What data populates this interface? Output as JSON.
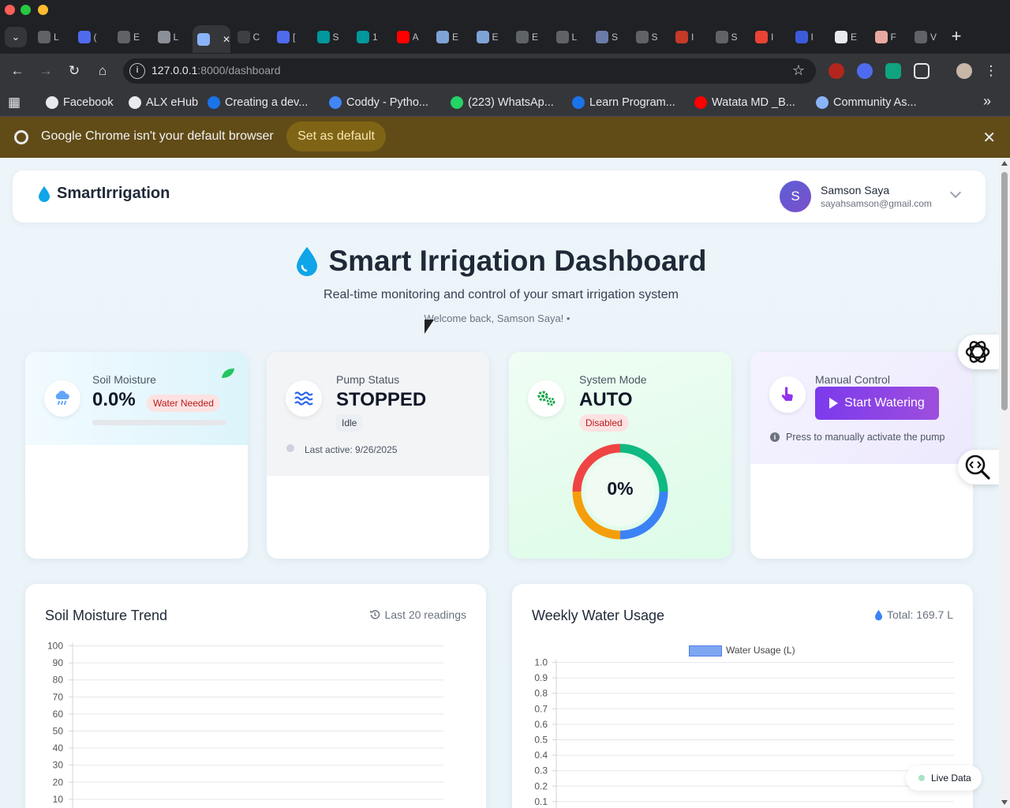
{
  "browser": {
    "tabs": [
      {
        "title": "L",
        "color": "#5f6368"
      },
      {
        "title": "(",
        "color": "#4f6bed"
      },
      {
        "title": "E",
        "color": "#5f6368"
      },
      {
        "title": "L",
        "color": "#8a8f98"
      },
      {
        "title": "",
        "color": "#8ab4f8",
        "active": true
      },
      {
        "title": "C",
        "color": "#3c4043"
      },
      {
        "title": "[",
        "color": "#4f6bed"
      },
      {
        "title": "S",
        "color": "#00979d"
      },
      {
        "title": "1",
        "color": "#00979d"
      },
      {
        "title": "A",
        "color": "#ff0000"
      },
      {
        "title": "E",
        "color": "#7ea3d6"
      },
      {
        "title": "E",
        "color": "#7ea3d6"
      },
      {
        "title": "E",
        "color": "#5f6368"
      },
      {
        "title": "L",
        "color": "#5f6368"
      },
      {
        "title": "S",
        "color": "#6b7aa8"
      },
      {
        "title": "S",
        "color": "#5f6368"
      },
      {
        "title": "I",
        "color": "#c53929"
      },
      {
        "title": "S",
        "color": "#5f6368"
      },
      {
        "title": "I",
        "color": "#ea4335"
      },
      {
        "title": "I",
        "color": "#3b5bdb"
      },
      {
        "title": "E",
        "color": "#e8eaed"
      },
      {
        "title": "F",
        "color": "#e8a9a0"
      },
      {
        "title": "V",
        "color": "#5f6368"
      }
    ],
    "url_host": "127.0.0.1",
    "url_path": ":8000/dashboard",
    "bookmarks": [
      {
        "label": "Facebook",
        "color": "#e8eaed"
      },
      {
        "label": "ALX eHub",
        "color": "#e8eaed"
      },
      {
        "label": "Creating a dev...",
        "color": "#1a73e8"
      },
      {
        "label": "Coddy - Pytho...",
        "color": "#4285f4"
      },
      {
        "label": "(223) WhatsAp...",
        "color": "#25d366"
      },
      {
        "label": "Learn Program...",
        "color": "#1a73e8"
      },
      {
        "label": "Watata MD _B...",
        "color": "#ff0000"
      },
      {
        "label": "Community As...",
        "color": "#8ab4f8"
      }
    ],
    "infobar": {
      "message": "Google Chrome isn't your default browser",
      "button": "Set as default"
    }
  },
  "app": {
    "brand": "SmartIrrigation",
    "user": {
      "initial": "S",
      "name": "Samson Saya",
      "email": "sayahsamson@gmail.com"
    },
    "title": "Smart Irrigation Dashboard",
    "subtitle": "Real-time monitoring and control of your smart irrigation system",
    "welcome": "Welcome back, Samson Saya! •"
  },
  "cards": {
    "moisture": {
      "label": "Soil Moisture",
      "value": "0.0%",
      "badge": "Water Needed",
      "level": 0
    },
    "pump": {
      "label": "Pump Status",
      "value": "STOPPED",
      "badge": "Idle",
      "last_active": "Last active: 9/26/2025"
    },
    "mode": {
      "label": "System Mode",
      "value": "AUTO",
      "badge": "Disabled",
      "gauge_label": "0%"
    },
    "manual": {
      "label": "Manual Control",
      "button": "Start Watering",
      "help": "Press to manually activate the pump"
    }
  },
  "charts": {
    "moisture_trend": {
      "title": "Soil Moisture Trend",
      "meta": "Last 20 readings"
    },
    "water_usage": {
      "title": "Weekly Water Usage",
      "meta": "Total: 169.7 L"
    }
  },
  "chart_data": [
    {
      "type": "line",
      "title": "Soil Moisture Trend",
      "y_ticks": [
        "100",
        "90",
        "80",
        "70",
        "60",
        "50",
        "40",
        "30",
        "20",
        "10"
      ],
      "ylim": [
        0,
        100
      ],
      "series": []
    },
    {
      "type": "bar",
      "title": "Weekly Water Usage",
      "legend": "Water Usage (L)",
      "y_ticks": [
        "1.0",
        "0.9",
        "0.8",
        "0.7",
        "0.6",
        "0.5",
        "0.4",
        "0.3",
        "0.2",
        "0.1"
      ],
      "ylim": [
        0,
        1.0
      ],
      "series": [
        {
          "name": "Water Usage (L)",
          "values": []
        }
      ]
    }
  ],
  "live": {
    "label": "Live Data"
  },
  "colors": {
    "accent": "#7c3aed",
    "danger": "#b91c1c",
    "water": "#0ea5e9"
  }
}
